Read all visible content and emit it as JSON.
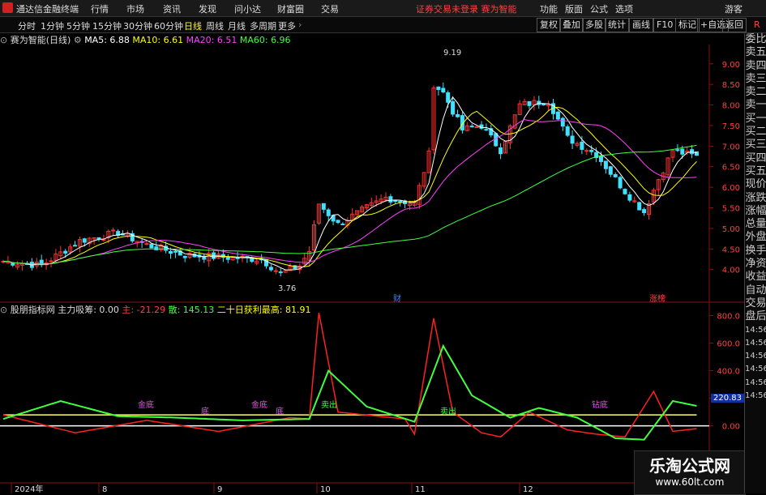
{
  "titlebar": {
    "app_name": "通达信金融终端",
    "menus": [
      "行情",
      "市场",
      "资讯",
      "发现",
      "问小达",
      "财富圈",
      "交易"
    ],
    "notice": "证券交易未登录  赛为智能",
    "right_menus": [
      "功能",
      "版面",
      "公式",
      "选项"
    ],
    "guest": "游客"
  },
  "toolbar": {
    "periods": [
      "分时",
      "1分钟",
      "5分钟",
      "15分钟",
      "30分钟",
      "60分钟",
      "日线",
      "周线",
      "月线",
      "多周期",
      "更多"
    ],
    "active_period": "日线",
    "buttons": [
      "复权",
      "叠加",
      "多股",
      "统计",
      "画线",
      "F10",
      "标记",
      "+自选",
      "返回"
    ]
  },
  "main_chart": {
    "stock_title": "赛为智能(日线)",
    "ma": [
      {
        "label": "MA5: ",
        "value": "6.88",
        "color": "#ffffff"
      },
      {
        "label": "MA10: ",
        "value": "6.61",
        "color": "#ffff00"
      },
      {
        "label": "MA20: ",
        "value": "6.51",
        "color": "#ff40ff"
      },
      {
        "label": "MA60: ",
        "value": "6.96",
        "color": "#40ff40"
      }
    ],
    "high_label": "9.19",
    "low_label": "3.76",
    "events": [
      {
        "text": "财",
        "color": "#4080ff"
      },
      {
        "text": "涨榜",
        "color": "#ff4040"
      }
    ],
    "y_axis": [
      "9.00",
      "8.50",
      "8.00",
      "7.50",
      "7.00",
      "6.50",
      "6.00",
      "5.50",
      "5.00",
      "4.50",
      "4.00"
    ]
  },
  "indicator": {
    "name": "股朋指标网",
    "main_force_label": "主力吸筹: ",
    "main_force_value": "0.00",
    "zhu_label": "主: ",
    "zhu_value": "-21.29",
    "san_label": "散: ",
    "san_value": "145.13",
    "max20_label": "二十日获利最高: ",
    "max20_value": "81.91",
    "y_axis": [
      "800.0",
      "600.0",
      "400.0",
      "200.0",
      "0.00"
    ],
    "current_value": "220.83",
    "markers": [
      {
        "text": "金底",
        "color": "#ff40ff"
      },
      {
        "text": "底",
        "color": "#ff40ff"
      },
      {
        "text": "金底",
        "color": "#ff40ff"
      },
      {
        "text": "底",
        "color": "#ff40ff"
      },
      {
        "text": "卖出",
        "color": "#40ff40"
      },
      {
        "text": "卖出",
        "color": "#40ff40"
      },
      {
        "text": "钻底",
        "color": "#ff40ff"
      }
    ]
  },
  "x_axis": [
    "2024年",
    "8",
    "9",
    "10",
    "11",
    "12"
  ],
  "side_panel": [
    "委比",
    "卖五",
    "卖四",
    "卖三",
    "卖二",
    "卖一",
    "买一",
    "买二",
    "买三",
    "买四",
    "买五",
    "现价",
    "涨跌",
    "涨幅",
    "总量",
    "外盘",
    "换手",
    "净资",
    "收益",
    "自动",
    "交易",
    "盘后",
    "14:56",
    "14:56",
    "14:56",
    "14:56",
    "14:56",
    "14:56"
  ],
  "watermark": {
    "title": "乐淘公式网",
    "url": "www.60lt.com"
  }
}
